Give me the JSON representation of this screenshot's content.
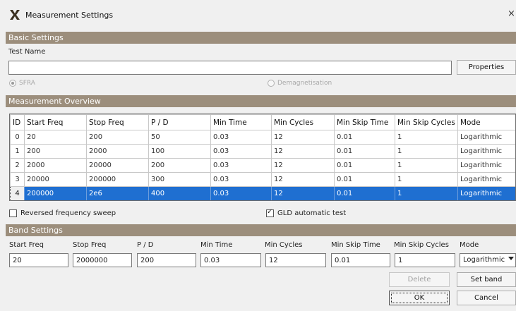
{
  "window": {
    "title": "Measurement Settings",
    "close_glyph": "×"
  },
  "basic": {
    "header": "Basic Settings",
    "test_name_label": "Test Name",
    "test_name_value": "",
    "properties_label": "Properties",
    "radio_sfra": "SFRA",
    "radio_demag": "Demagnetisation"
  },
  "overview": {
    "header": "Measurement Overview",
    "columns": [
      "ID",
      "Start Freq",
      "Stop Freq",
      "P / D",
      "Min Time",
      "Min Cycles",
      "Min Skip Time",
      "Min Skip Cycles",
      "Mode"
    ],
    "rows": [
      [
        "0",
        "20",
        "200",
        "50",
        "0.03",
        "12",
        "0.01",
        "1",
        "Logarithmic"
      ],
      [
        "1",
        "200",
        "2000",
        "100",
        "0.03",
        "12",
        "0.01",
        "1",
        "Logarithmic"
      ],
      [
        "2",
        "2000",
        "20000",
        "200",
        "0.03",
        "12",
        "0.01",
        "1",
        "Logarithmic"
      ],
      [
        "3",
        "20000",
        "200000",
        "300",
        "0.03",
        "12",
        "0.01",
        "1",
        "Logarithmic"
      ],
      [
        "4",
        "200000",
        "2e6",
        "400",
        "0.03",
        "12",
        "0.01",
        "1",
        "Logarithmic"
      ]
    ],
    "selected_row": 4
  },
  "options": {
    "reversed_label": "Reversed frequency sweep",
    "reversed_checked": false,
    "gld_label": "GLD automatic test",
    "gld_checked": true
  },
  "band": {
    "header": "Band Settings",
    "labels": {
      "start_freq": "Start Freq",
      "stop_freq": "Stop Freq",
      "pd": "P / D",
      "min_time": "Min Time",
      "min_cycles": "Min Cycles",
      "min_skip_time": "Min Skip Time",
      "min_skip_cycles": "Min Skip Cycles",
      "mode": "Mode"
    },
    "values": {
      "start_freq": "20",
      "stop_freq": "2000000",
      "pd": "200",
      "min_time": "0.03",
      "min_cycles": "12",
      "min_skip_time": "0.01",
      "min_skip_cycles": "1",
      "mode": "Logarithmic"
    }
  },
  "buttons": {
    "delete": "Delete",
    "set_band": "Set band",
    "ok": "OK",
    "cancel": "Cancel"
  },
  "colors": {
    "section_header": "#9c8e7c",
    "selection": "#1f6fd1"
  }
}
